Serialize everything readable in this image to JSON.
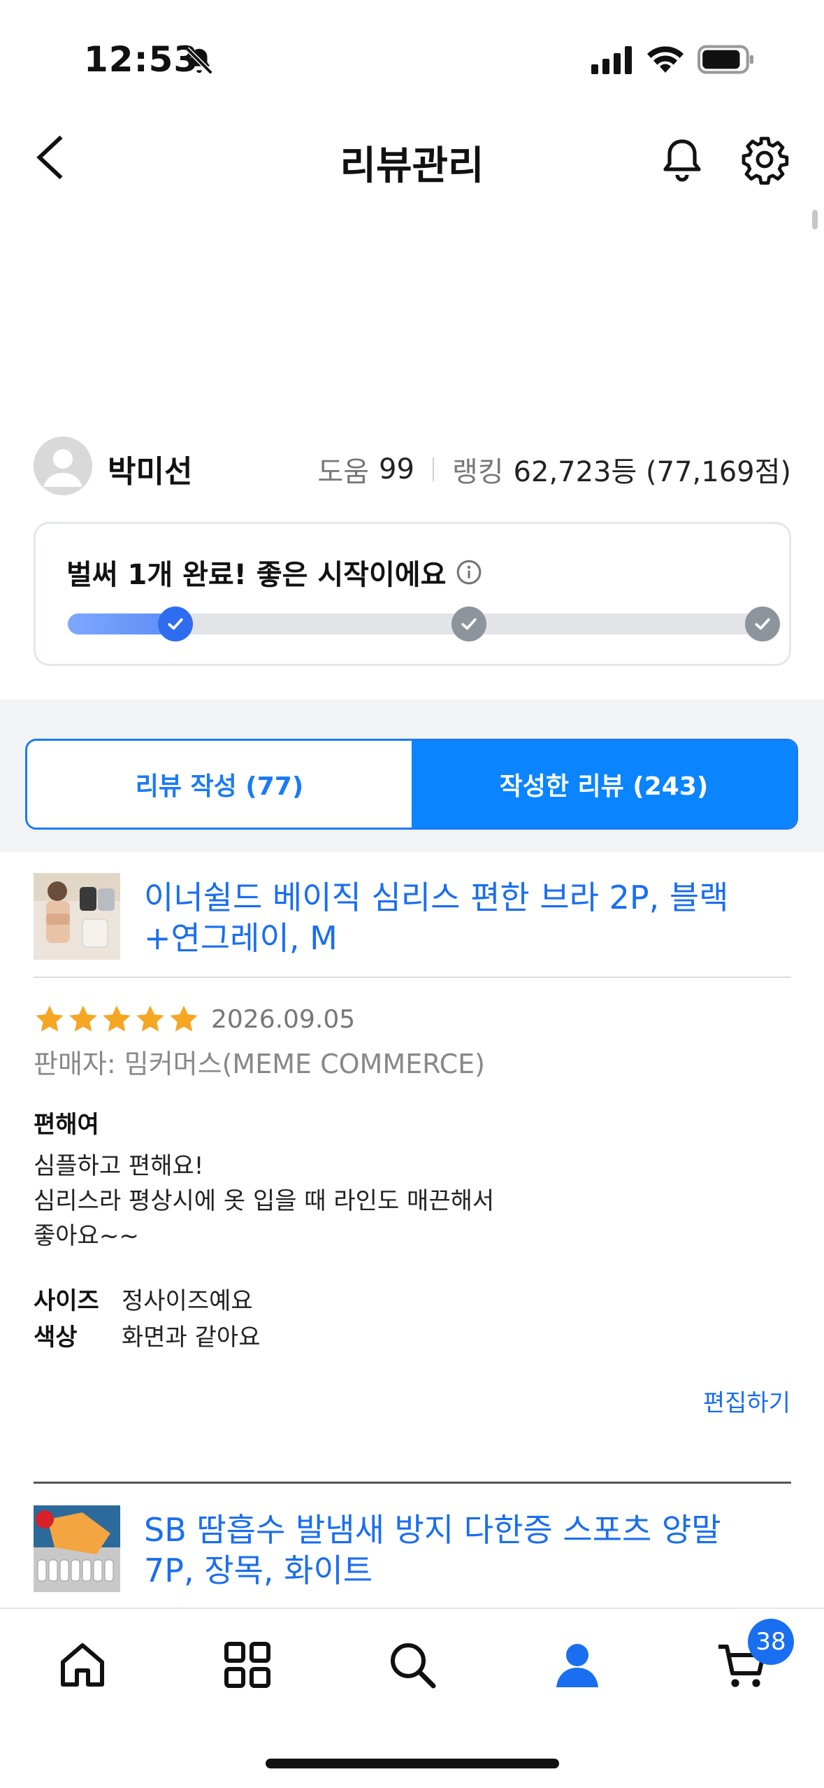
{
  "status_bar": {
    "time": "12:53"
  },
  "header": {
    "title": "리뷰관리"
  },
  "profile": {
    "name": "박미선",
    "help_label": "도움",
    "help_value": "99",
    "ranking_label": "랭킹",
    "ranking_value": "62,723등 (77,169점)"
  },
  "progress": {
    "title": "벌써 1개 완료! 좋은 시작이에요",
    "completed_steps": 1,
    "total_steps": 3
  },
  "tabs": {
    "write_label": "리뷰 작성 (77)",
    "written_label": "작성한 리뷰 (243)",
    "active": "written"
  },
  "reviews": [
    {
      "product_name": "이너쉴드 베이직 심리스 편한 브라 2P, 블랙+연그레이, M",
      "rating": 5,
      "date": "2026.09.05",
      "seller": "판매자: 밈커머스(MEME COMMERCE)",
      "title": "편해여",
      "body_lines": [
        "심플하고 편해요!",
        "심리스라 평상시에 옷 입을 때 라인도 매끈해서",
        "좋아요~~"
      ],
      "attributes": [
        {
          "key": "사이즈",
          "value": "정사이즈예요"
        },
        {
          "key": "색상",
          "value": "화면과 같아요"
        }
      ],
      "edit_label": "편집하기"
    },
    {
      "product_name": "SB 땀흡수 발냄새 방지 다한증 스포츠 양말 7P, 장목, 화이트"
    }
  ],
  "bottom_nav": {
    "items": [
      "home-icon",
      "categories-icon",
      "search-icon",
      "my-page-icon",
      "cart-icon"
    ],
    "active": "my-page-icon",
    "cart_count": "38"
  },
  "colors": {
    "accent": "#0a84ff",
    "link": "#1a6ef0",
    "star": "#f5a623",
    "progress_fill": "#5d8ef5"
  }
}
